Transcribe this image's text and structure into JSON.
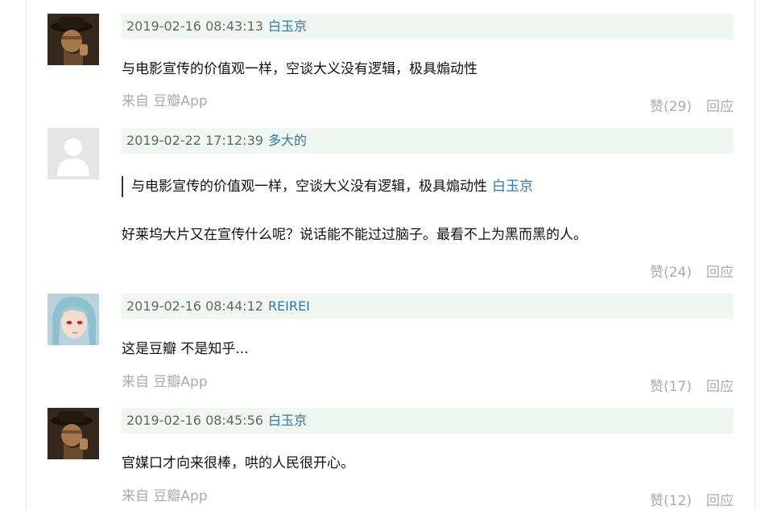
{
  "comments": [
    {
      "avatar_icon": "man-hat-avatar-icon",
      "time": "2019-02-16 08:43:13",
      "user": "白玉京",
      "text": "与电影宣传的价值观一样，空谈大义没有逻辑，极具煽动性",
      "source": "来自 豆瓣App",
      "likes": "赞(29)",
      "reply": "回应"
    },
    {
      "avatar_icon": "default-user-avatar-icon",
      "time": "2019-02-22 17:12:39",
      "user": "多大的",
      "quote_text": "与电影宣传的价值观一样，空谈大义没有逻辑，极具煽动性",
      "quote_user": "白玉京",
      "text": "好莱坞大片又在宣传什么呢？说话能不能过过脑子。最看不上为黑而黑的人。",
      "likes": "赞(24)",
      "reply": "回应"
    },
    {
      "avatar_icon": "anime-girl-avatar-icon",
      "time": "2019-02-16 08:44:12",
      "user": "REIREI",
      "text": "这是豆瓣 不是知乎...",
      "source": "来自 豆瓣App",
      "likes": "赞(17)",
      "reply": "回应"
    },
    {
      "avatar_icon": "man-hat-avatar-icon",
      "time": "2019-02-16 08:45:56",
      "user": "白玉京",
      "text": "官媒口才向来很棒，哄的人民很开心。",
      "source": "来自 豆瓣App",
      "likes": "赞(12)",
      "reply": "回应"
    }
  ]
}
